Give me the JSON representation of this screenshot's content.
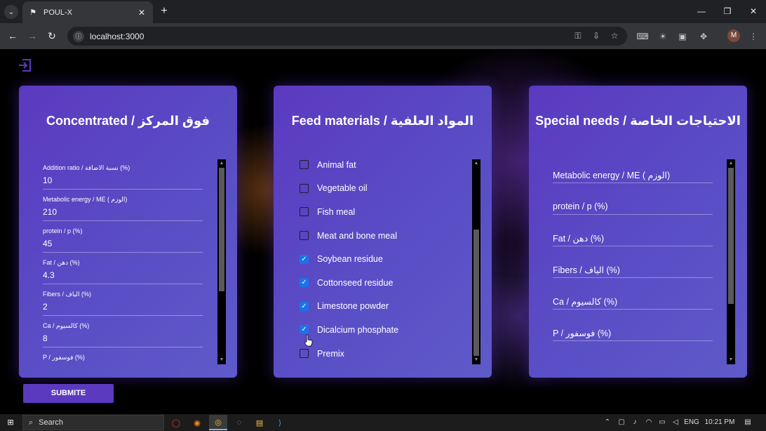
{
  "browser": {
    "tab_title": "POUL-X",
    "url": "localhost:3000",
    "profile_initial": "M"
  },
  "cards": {
    "concentrated": {
      "title": "Concentrated / فوق المركز",
      "fields": [
        {
          "label": "Addition ratio / نسبة الاضافة (%)",
          "value": "10"
        },
        {
          "label": "Metabolic energy / ME ( الوزم)",
          "value": "210"
        },
        {
          "label": "protein / p (%)",
          "value": "45"
        },
        {
          "label": "Fat / دهن (%)",
          "value": "4.3"
        },
        {
          "label": "Fibers / الياف (%)",
          "value": "2"
        },
        {
          "label": "Ca / كالسيوم (%)",
          "value": "8"
        },
        {
          "label": "P / فوسفور (%)",
          "value": ""
        }
      ]
    },
    "feed": {
      "title": "Feed materials / المواد العلفية",
      "items": [
        {
          "label": "Animal fat",
          "checked": false
        },
        {
          "label": "Vegetable oil",
          "checked": false
        },
        {
          "label": "Fish meal",
          "checked": false
        },
        {
          "label": "Meat and bone meal",
          "checked": false
        },
        {
          "label": "Soybean residue",
          "checked": true
        },
        {
          "label": "Cottonseed residue",
          "checked": true
        },
        {
          "label": "Limestone powder",
          "checked": true
        },
        {
          "label": "Dicalcium phosphate",
          "checked": true
        },
        {
          "label": "Premix",
          "checked": false
        }
      ]
    },
    "special": {
      "title": "Special needs / الاحتياجات الخاصة",
      "fields": [
        {
          "placeholder": "Metabolic energy / ME ( الوزم)"
        },
        {
          "placeholder": "protein / p (%)"
        },
        {
          "placeholder": "Fat / دهن (%)"
        },
        {
          "placeholder": "Fibers / الياف (%)"
        },
        {
          "placeholder": "Ca / كالسيوم (%)"
        },
        {
          "placeholder": "P / فوسفور (%)"
        }
      ]
    }
  },
  "submit_label": "SUBMITE",
  "taskbar": {
    "search_placeholder": "Search",
    "language": "ENG",
    "time": "10:21 PM"
  }
}
